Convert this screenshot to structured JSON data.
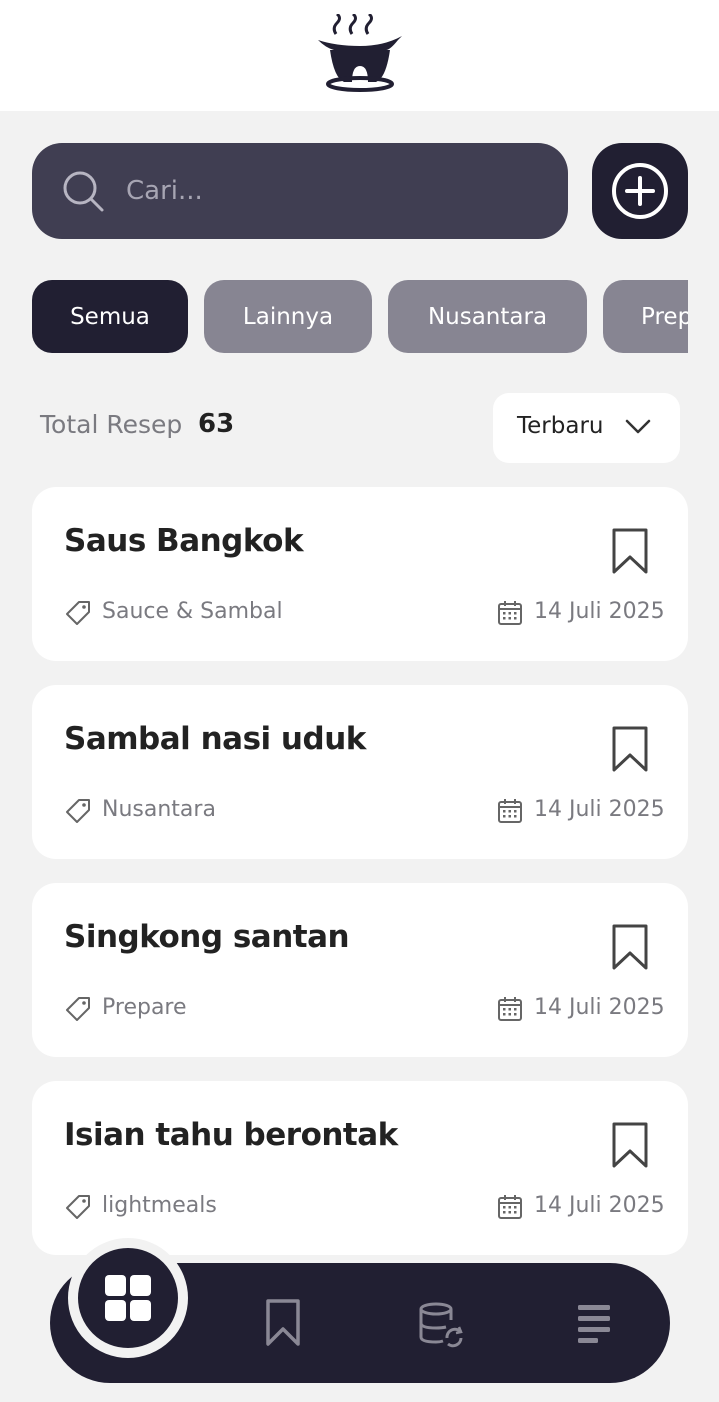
{
  "search": {
    "placeholder": "Cari..."
  },
  "categories": [
    "Semua",
    "Lainnya",
    "Nusantara",
    "Prepare"
  ],
  "total": {
    "label": "Total Resep",
    "count": "63"
  },
  "sort": {
    "label": "Terbaru"
  },
  "recipes": [
    {
      "title": "Saus Bangkok",
      "category": "Sauce & Sambal",
      "date": "14 Juli 2025"
    },
    {
      "title": "Sambal nasi uduk",
      "category": "Nusantara",
      "date": "14 Juli 2025"
    },
    {
      "title": "Singkong santan",
      "category": "Prepare",
      "date": "14 Juli 2025"
    },
    {
      "title": "Isian tahu berontak",
      "category": "lightmeals",
      "date": "14 Juli 2025"
    }
  ],
  "icons": {
    "logo": "steaming-pot-logo",
    "search": "search-icon",
    "add": "plus-circle-icon",
    "sort": "chevron-down-icon",
    "bookmark": "bookmark-icon",
    "tag": "tag-icon",
    "date": "calendar-icon",
    "nav": [
      "grid-icon",
      "bookmark-icon",
      "database-sync-icon",
      "list-icon"
    ]
  },
  "colors": {
    "primary": "#211f32",
    "search_bg": "#403e52",
    "chip_inactive": "#878592",
    "background": "#f2f2f2",
    "card": "#ffffff",
    "muted_text": "#7a7a80"
  }
}
